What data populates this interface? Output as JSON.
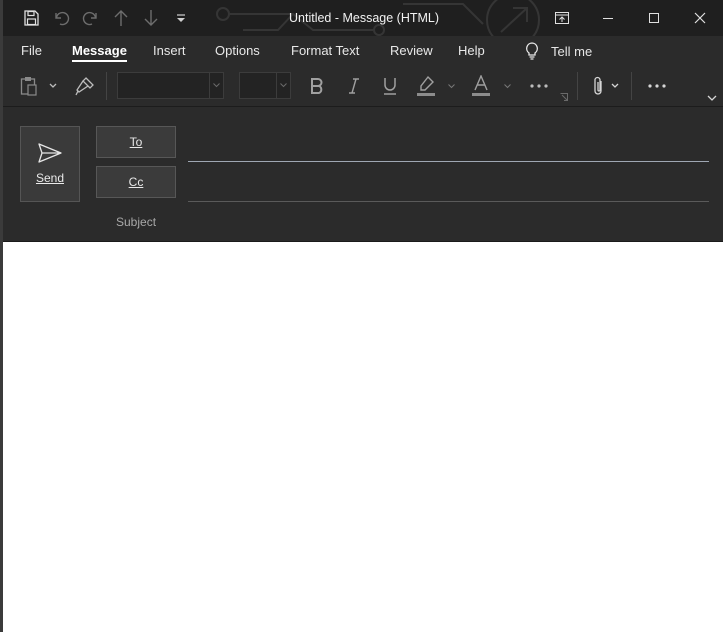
{
  "window": {
    "title": "Untitled  -  Message (HTML)"
  },
  "quick_access": [
    {
      "name": "save-icon"
    },
    {
      "name": "undo-icon"
    },
    {
      "name": "redo-icon"
    },
    {
      "name": "up-arrow-icon"
    },
    {
      "name": "down-arrow-icon"
    },
    {
      "name": "customize-qat-icon"
    }
  ],
  "menu_tabs": [
    {
      "label": "File"
    },
    {
      "label": "Message",
      "active": true
    },
    {
      "label": "Insert"
    },
    {
      "label": "Options"
    },
    {
      "label": "Format Text"
    },
    {
      "label": "Review"
    },
    {
      "label": "Help"
    }
  ],
  "tell_me": {
    "label": "Tell me"
  },
  "ribbon": {
    "font_name": "",
    "font_size": "",
    "more": "···"
  },
  "compose": {
    "send_label": "Send",
    "to_label": "To",
    "cc_label": "Cc",
    "subject_label": "Subject",
    "to_value": "",
    "cc_value": "",
    "subject_value": ""
  },
  "colors": {
    "titlebar": "#1f1f1f",
    "ribbon": "#2b2b2b",
    "body": "#ffffff",
    "button": "#3a3a3a"
  }
}
